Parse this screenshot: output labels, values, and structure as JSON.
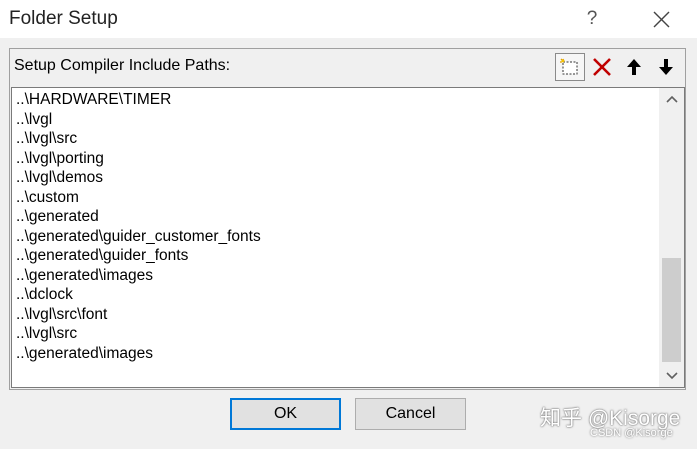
{
  "window": {
    "title": "Folder Setup",
    "help_label": "?"
  },
  "header": {
    "label": "Setup Compiler Include Paths:"
  },
  "toolbar": {
    "buttons": [
      {
        "name": "new-icon"
      },
      {
        "name": "delete-icon",
        "color": "#c00000"
      },
      {
        "name": "move-up-icon"
      },
      {
        "name": "move-down-icon"
      }
    ]
  },
  "paths": [
    "..\\HARDWARE\\TIMER",
    "..\\lvgl",
    "..\\lvgl\\src",
    "..\\lvgl\\porting",
    "..\\lvgl\\demos",
    "..\\custom",
    "..\\generated",
    "..\\generated\\guider_customer_fonts",
    "..\\generated\\guider_fonts",
    "..\\generated\\images",
    "..\\dclock",
    "..\\lvgl\\src\\font",
    "..\\lvgl\\src",
    "..\\generated\\images"
  ],
  "buttons": {
    "ok_label": "OK",
    "cancel_label": "Cancel"
  },
  "watermark": {
    "main": "知乎 @Kisorge",
    "sub": "CSDN @Kisorge"
  },
  "colors": {
    "accent": "#0078d7",
    "delete": "#c00000"
  }
}
